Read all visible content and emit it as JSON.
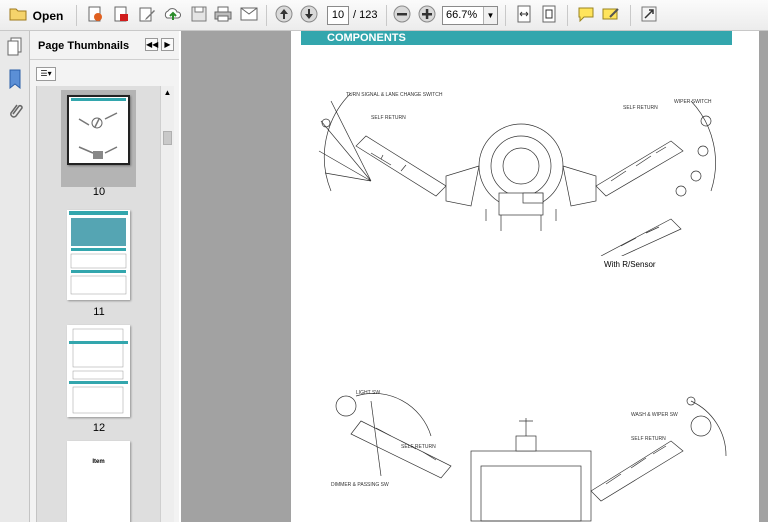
{
  "toolbar": {
    "open_label": "Open",
    "current_page": "10",
    "total_pages": "/ 123",
    "zoom": "66.7%",
    "icons": [
      "open-folder-icon",
      "create-pdf-icon",
      "acrobat-icon",
      "edit-icon",
      "upload-icon",
      "save-icon",
      "print-icon",
      "email-icon",
      "prev-page-icon",
      "next-page-icon",
      "zoom-out-icon",
      "zoom-in-icon",
      "fit-width-icon",
      "fit-page-icon",
      "comment-icon",
      "sign-icon",
      "expand-icon"
    ]
  },
  "sidebar": {
    "title": "Page Thumbnails",
    "thumbnails": [
      {
        "number": "10",
        "selected": true
      },
      {
        "number": "11",
        "selected": false
      },
      {
        "number": "12",
        "selected": false
      },
      {
        "number": "",
        "selected": false,
        "heading": "Item"
      }
    ]
  },
  "document": {
    "section_title": "COMPONENTS",
    "caption": "With R/Sensor",
    "labels_top": [
      "TURN SIGNAL & LANE CHANGE SWITCH",
      "SELF RETURN",
      "SELF RETURN",
      "WIPER SWITCH"
    ],
    "labels_bottom": [
      "LIGHT SW",
      "SELF RETURN",
      "DIMMER & PASSING SW",
      "WASH & WIPER SW",
      "SELF RETURN"
    ]
  }
}
